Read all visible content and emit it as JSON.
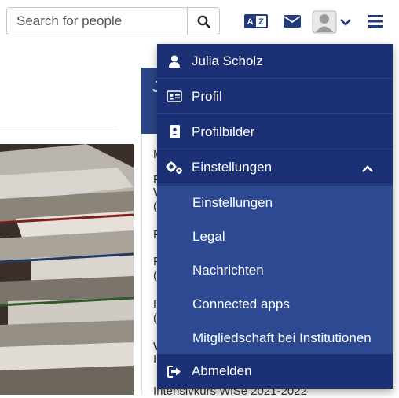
{
  "header": {
    "search": {
      "placeholder": "Search for people",
      "value": ""
    }
  },
  "menu": {
    "user_name": "Julia Scholz",
    "items": [
      {
        "label": "Profil"
      },
      {
        "label": "Profilbilder"
      },
      {
        "label": "Einstellungen"
      }
    ],
    "submenu": [
      {
        "label": "Einstellungen"
      },
      {
        "label": "Legal"
      },
      {
        "label": "Nachrichten"
      },
      {
        "label": "Connected apps"
      },
      {
        "label": "Mitgliedschaft bei Institutionen"
      }
    ],
    "logout": "Abmelden"
  },
  "background": {
    "card_initial": "J",
    "lines": [
      "M",
      "F",
      "W",
      "(",
      "F",
      "F",
      "(",
      "F",
      "(",
      "W",
      "I"
    ],
    "bottom_text": "Intensivkurs WiSe 2021-2022"
  },
  "colors": {
    "menu_bg": "#1c3175",
    "submenu_bg": "#2d4991",
    "header_icon": "#1f3a7d"
  }
}
